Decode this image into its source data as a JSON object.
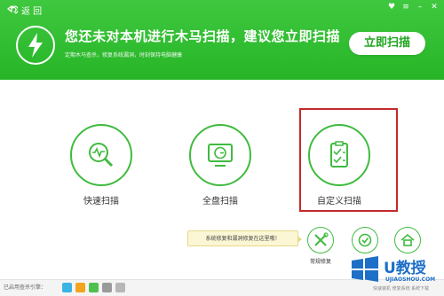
{
  "header": {
    "back_label": "返 回",
    "headline": "您还未对本机进行木马扫描，建议您立即扫描",
    "subline": "定期木马查杀，修复系统漏洞，时刻保持电脑健康",
    "scan_now_label": "立即扫描",
    "bg_color": "#2fbd2f",
    "window_controls": [
      "skin-icon",
      "menu-icon",
      "minimize-icon",
      "close-icon"
    ]
  },
  "options": [
    {
      "label": "快速扫描",
      "icon": "quick-scan-icon"
    },
    {
      "label": "全盘扫描",
      "icon": "full-scan-icon"
    },
    {
      "label": "自定义扫描",
      "icon": "custom-scan-icon"
    }
  ],
  "tip": "系统修复和漏洞修复在这里哦！",
  "tools": [
    {
      "label": "常规修复",
      "icon": "repair-tools-icon"
    },
    {
      "label": "",
      "icon": "vulnerability-repair-icon"
    },
    {
      "label": "",
      "icon": "system-home-icon"
    }
  ],
  "footer": {
    "enabled_label": "已启用查杀引擎："
  },
  "watermark": {
    "brand": "U教授",
    "url": "UJIAOSHOU.COM",
    "tags": "快速装机  修复系统  系统下载"
  },
  "accent_color": "#3fbb3f",
  "highlight_color": "#c22a2a"
}
